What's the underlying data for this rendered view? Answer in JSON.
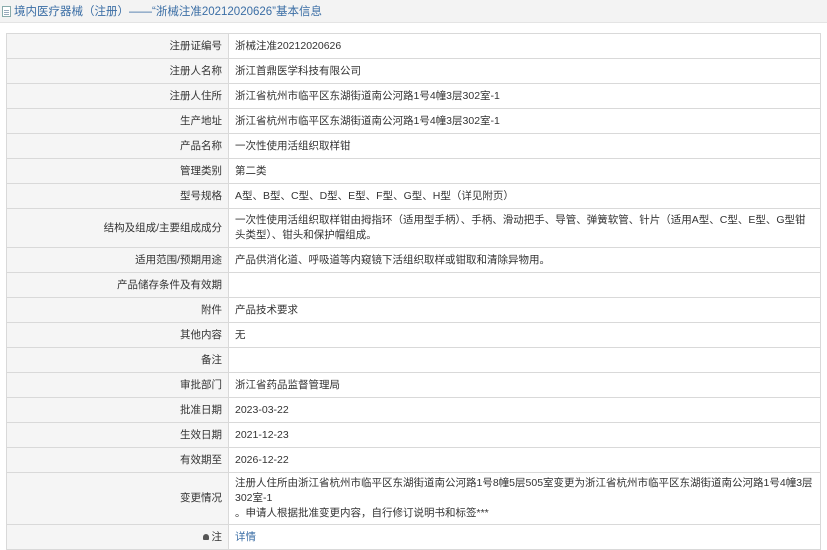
{
  "header": {
    "title": "境内医疗器械（注册）——“浙械注准20212020626”基本信息"
  },
  "rows": [
    {
      "label": "注册证编号",
      "value": "浙械注准20212020626"
    },
    {
      "label": "注册人名称",
      "value": "浙江首鼎医学科技有限公司"
    },
    {
      "label": "注册人住所",
      "value": "浙江省杭州市临平区东湖街道南公河路1号4幢3层302室-1"
    },
    {
      "label": "生产地址",
      "value": "浙江省杭州市临平区东湖街道南公河路1号4幢3层302室-1"
    },
    {
      "label": "产品名称",
      "value": "一次性使用活组织取样钳"
    },
    {
      "label": "管理类别",
      "value": "第二类"
    },
    {
      "label": "型号规格",
      "value": "A型、B型、C型、D型、E型、F型、G型、H型（详见附页）"
    },
    {
      "label": "结构及组成/主要组成成分",
      "value": "一次性使用活组织取样钳由拇指环（适用型手柄）、手柄、滑动把手、导管、弹簧软管、针片（适用A型、C型、E型、G型钳头类型）、钳头和保护帽组成。"
    },
    {
      "label": "适用范围/预期用途",
      "value": "产品供消化道、呼吸道等内窥镜下活组织取样或钳取和清除异物用。"
    },
    {
      "label": "产品储存条件及有效期",
      "value": ""
    },
    {
      "label": "附件",
      "value": "产品技术要求"
    },
    {
      "label": "其他内容",
      "value": "无"
    },
    {
      "label": "备注",
      "value": ""
    },
    {
      "label": "审批部门",
      "value": "浙江省药品监督管理局"
    },
    {
      "label": "批准日期",
      "value": "2023-03-22"
    },
    {
      "label": "生效日期",
      "value": "2021-12-23"
    },
    {
      "label": "有效期至",
      "value": "2026-12-22"
    },
    {
      "label": "变更情况",
      "value": "注册人住所由浙江省杭州市临平区东湖街道南公河路1号8幢5层505室变更为浙江省杭州市临平区东湖街道南公河路1号4幢3层302室-1\n。申请人根据批准变更内容，自行修订说明书和标签***"
    }
  ],
  "footer": {
    "label": "注",
    "link_text": "详情"
  },
  "icons": {
    "header": "document-icon",
    "footer": "lock-icon"
  },
  "colors": {
    "link": "#3b6ea5",
    "label_bg": "#f5f5f5",
    "border": "#d9d9d9"
  }
}
